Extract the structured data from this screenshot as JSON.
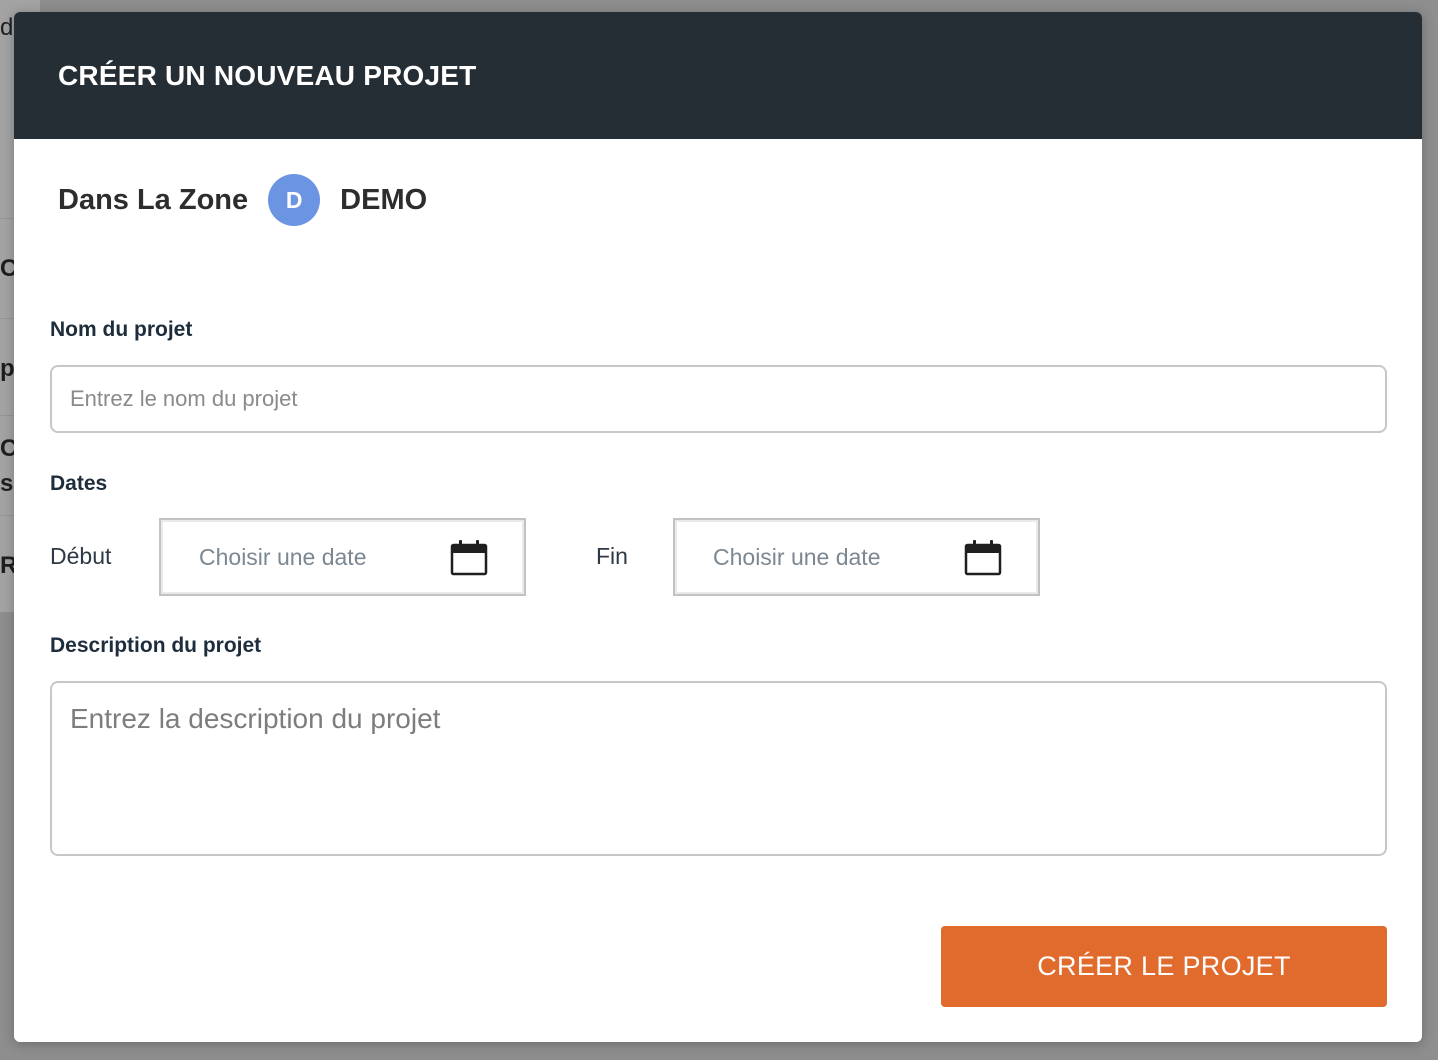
{
  "background": {
    "fragments": [
      "d",
      "C",
      "p",
      "C",
      "si",
      "R"
    ]
  },
  "modal": {
    "title": "CRÉER UN NOUVEAU PROJET",
    "org_name": "Dans La Zone",
    "avatar_letter": "D",
    "workspace_name": "DEMO"
  },
  "form": {
    "name_label": "Nom du projet",
    "name_placeholder": "Entrez le nom du projet",
    "name_value": "",
    "dates_label": "Dates",
    "start_label": "Début",
    "start_placeholder": "Choisir une date",
    "end_label": "Fin",
    "end_placeholder": "Choisir une date",
    "description_label": "Description du projet",
    "description_placeholder": "Entrez la description du projet",
    "description_value": "",
    "submit_label": "CRÉER LE PROJET"
  },
  "icons": {
    "start_date_icon": "calendar-icon",
    "end_date_icon": "calendar-icon"
  },
  "colors": {
    "header_bg": "#262e35",
    "avatar_bg": "#6b95e3",
    "submit_bg": "#e06b2c"
  }
}
